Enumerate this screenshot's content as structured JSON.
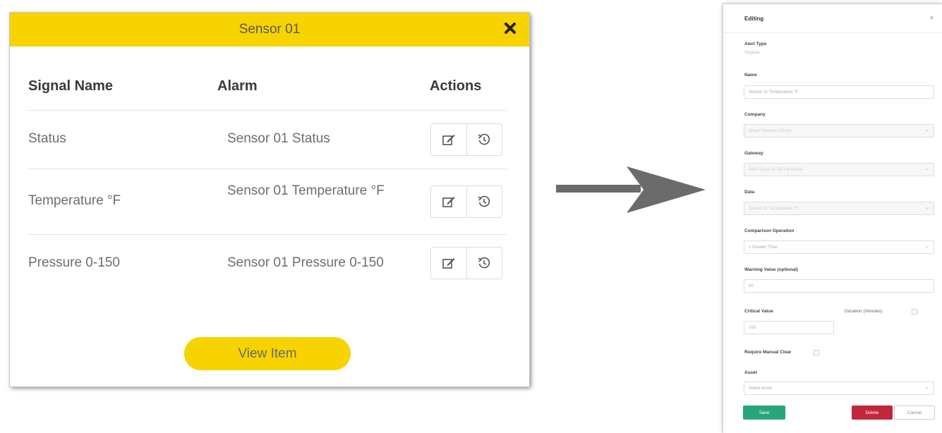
{
  "popup": {
    "title": "Sensor 01",
    "columns": {
      "signal": "Signal Name",
      "alarm": "Alarm",
      "actions": "Actions"
    },
    "rows": [
      {
        "signal": "Status",
        "alarm": "Sensor 01 Status"
      },
      {
        "signal": "Temperature °F",
        "alarm": "Sensor 01 Temperature °F"
      },
      {
        "signal": "Pressure 0-150",
        "alarm": "Sensor 01 Pressure 0-150"
      }
    ],
    "view_button": "View Item",
    "icons": {
      "close": "close-icon",
      "edit": "edit-icon",
      "history": "history-icon"
    }
  },
  "form": {
    "title": "Editing",
    "close": "×",
    "alert_type": {
      "label": "Alert Type",
      "value": "Singular"
    },
    "name": {
      "label": "Name",
      "value": "Sensor 01 Temperature °F"
    },
    "company": {
      "label": "Company",
      "value": "Smart Solutions Group"
    },
    "gateway": {
      "label": "Gateway",
      "value": "SSG Cloud ID Tall Pal Group"
    },
    "data": {
      "label": "Data",
      "value": "Sensor 01 Temperature °F"
    },
    "comparison": {
      "label": "Comparison Operation",
      "value": "> Greater Than"
    },
    "warning": {
      "label": "Warning Value (optional)",
      "value": "90"
    },
    "critical": {
      "label": "Critical Value",
      "value": "100"
    },
    "duration": {
      "label": "Duration (minutes)"
    },
    "manual_clear": {
      "label": "Require Manual Clear"
    },
    "asset": {
      "label": "Asset",
      "value": "Select Asset"
    },
    "save": "Save",
    "delete": "Delete",
    "cancel": "Cancel"
  },
  "colors": {
    "accent": "#f7d300",
    "save": "#2aa57a",
    "delete": "#c0273b"
  }
}
